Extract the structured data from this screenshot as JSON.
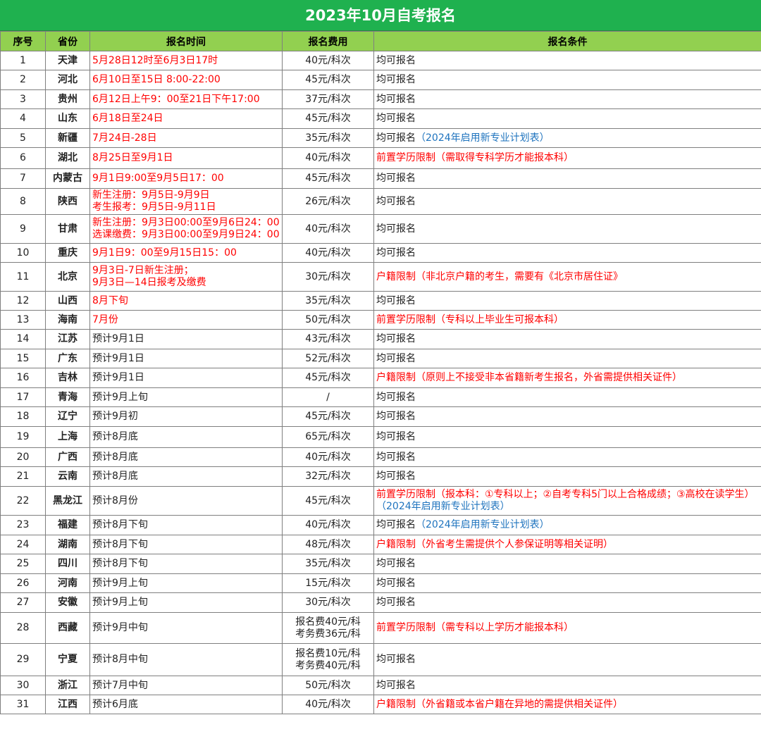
{
  "title": "2023年10月自考报名",
  "headers": [
    "序号",
    "省份",
    "报名时间",
    "报名费用",
    "报名条件"
  ],
  "colors": {
    "title_bg": "#1fb14f",
    "header_bg": "#92d050",
    "highlight_red": "#ff0000",
    "link_blue": "#1e73be"
  },
  "rows": [
    {
      "no": "1",
      "province": "天津",
      "time": "5月28日12时至6月3日17时",
      "time_red": true,
      "fee": "40元/科次",
      "cond": "均可报名",
      "cond_red": false,
      "note": ""
    },
    {
      "no": "2",
      "province": "河北",
      "time": "6月10日至15日 8:00-22:00",
      "time_red": true,
      "fee": "45元/科次",
      "cond": "均可报名",
      "cond_red": false,
      "note": ""
    },
    {
      "no": "3",
      "province": "贵州",
      "time": "6月12日上午9：00至21日下午17:00",
      "time_red": true,
      "fee": "37元/科次",
      "cond": "均可报名",
      "cond_red": false,
      "note": ""
    },
    {
      "no": "4",
      "province": "山东",
      "time": "6月18日至24日",
      "time_red": true,
      "fee": "45元/科次",
      "cond": "均可报名",
      "cond_red": false,
      "note": ""
    },
    {
      "no": "5",
      "province": "新疆",
      "time": "7月24日-28日",
      "time_red": true,
      "fee": "35元/科次",
      "cond": "均可报名",
      "cond_red": false,
      "note": "（2024年启用新专业计划表）"
    },
    {
      "no": "6",
      "province": "湖北",
      "time": "8月25日至9月1日",
      "time_red": true,
      "fee": "40元/科次",
      "cond": "前置学历限制（需取得专科学历才能报本科）",
      "cond_red": true,
      "note": ""
    },
    {
      "no": "7",
      "province": "内蒙古",
      "time": "9月1日9:00至9月5日17：00",
      "time_red": true,
      "fee": "45元/科次",
      "cond": "均可报名",
      "cond_red": false,
      "note": ""
    },
    {
      "no": "8",
      "province": "陕西",
      "time": "新生注册：9月5日-9月9日\n考生报考：9月5日-9月11日",
      "time_red": true,
      "fee": "26元/科次",
      "cond": "均可报名",
      "cond_red": false,
      "note": ""
    },
    {
      "no": "9",
      "province": "甘肃",
      "time": "新生注册：9月3日00:00至9月6日24：00\n选课缴费：9月3日00:00至9月9日24：00",
      "time_red": true,
      "fee": "40元/科次",
      "cond": "均可报名",
      "cond_red": false,
      "note": ""
    },
    {
      "no": "10",
      "province": "重庆",
      "time": "9月1日9：00至9月15日15：00",
      "time_red": true,
      "fee": "40元/科次",
      "cond": "均可报名",
      "cond_red": false,
      "note": ""
    },
    {
      "no": "11",
      "province": "北京",
      "time": "9月3日-7日新生注册；\n9月3日—14日报考及缴费",
      "time_red": true,
      "fee": "30元/科次",
      "cond": "户籍限制（非北京户籍的考生，需要有《北京市居住证》",
      "cond_red": true,
      "note": ""
    },
    {
      "no": "12",
      "province": "山西",
      "time": "8月下旬",
      "time_red": true,
      "fee": "35元/科次",
      "cond": "均可报名",
      "cond_red": false,
      "note": ""
    },
    {
      "no": "13",
      "province": "海南",
      "time": "7月份",
      "time_red": true,
      "fee": "50元/科次",
      "cond": "前置学历限制（专科以上毕业生可报本科）",
      "cond_red": true,
      "note": ""
    },
    {
      "no": "14",
      "province": "江苏",
      "time": "预计9月1日",
      "time_red": false,
      "fee": "43元/科次",
      "cond": "均可报名",
      "cond_red": false,
      "note": ""
    },
    {
      "no": "15",
      "province": "广东",
      "time": "预计9月1日",
      "time_red": false,
      "fee": "52元/科次",
      "cond": "均可报名",
      "cond_red": false,
      "note": ""
    },
    {
      "no": "16",
      "province": "吉林",
      "time": "预计9月1日",
      "time_red": false,
      "fee": "45元/科次",
      "cond": "户籍限制（原则上不接受非本省籍新考生报名，外省需提供相关证件）",
      "cond_red": true,
      "note": ""
    },
    {
      "no": "17",
      "province": "青海",
      "time": "预计9月上旬",
      "time_red": false,
      "fee": "/",
      "cond": "均可报名",
      "cond_red": false,
      "note": ""
    },
    {
      "no": "18",
      "province": "辽宁",
      "time": "预计9月初",
      "time_red": false,
      "fee": "45元/科次",
      "cond": "均可报名",
      "cond_red": false,
      "note": ""
    },
    {
      "no": "19",
      "province": "上海",
      "time": "预计8月底",
      "time_red": false,
      "fee": "65元/科次",
      "cond": "均可报名",
      "cond_red": false,
      "note": ""
    },
    {
      "no": "20",
      "province": "广西",
      "time": "预计8月底",
      "time_red": false,
      "fee": "40元/科次",
      "cond": "均可报名",
      "cond_red": false,
      "note": ""
    },
    {
      "no": "21",
      "province": "云南",
      "time": "预计8月底",
      "time_red": false,
      "fee": "32元/科次",
      "cond": "均可报名",
      "cond_red": false,
      "note": ""
    },
    {
      "no": "22",
      "province": "黑龙江",
      "time": "预计8月份",
      "time_red": false,
      "fee": "45元/科次",
      "cond": "前置学历限制（报本科：①专科以上；②自考专科5门以上合格成绩；③高校在读学生）",
      "cond_red": true,
      "note": "（2024年启用新专业计划表）"
    },
    {
      "no": "23",
      "province": "福建",
      "time": "预计8月下旬",
      "time_red": false,
      "fee": "40元/科次",
      "cond": "均可报名",
      "cond_red": false,
      "note": "（2024年启用新专业计划表）"
    },
    {
      "no": "24",
      "province": "湖南",
      "time": "预计8月下旬",
      "time_red": false,
      "fee": "48元/科次",
      "cond": "户籍限制（外省考生需提供个人参保证明等相关证明）",
      "cond_red": true,
      "note": ""
    },
    {
      "no": "25",
      "province": "四川",
      "time": "预计8月下旬",
      "time_red": false,
      "fee": "35元/科次",
      "cond": "均可报名",
      "cond_red": false,
      "note": ""
    },
    {
      "no": "26",
      "province": "河南",
      "time": "预计9月上旬",
      "time_red": false,
      "fee": "15元/科次",
      "cond": "均可报名",
      "cond_red": false,
      "note": ""
    },
    {
      "no": "27",
      "province": "安徽",
      "time": "预计9月上旬",
      "time_red": false,
      "fee": "30元/科次",
      "cond": "均可报名",
      "cond_red": false,
      "note": ""
    },
    {
      "no": "28",
      "province": "西藏",
      "time": "预计9月中旬",
      "time_red": false,
      "fee": "报名费40元/科\n考务费36元/科",
      "cond": "前置学历限制（需专科以上学历才能报本科）",
      "cond_red": true,
      "note": ""
    },
    {
      "no": "29",
      "province": "宁夏",
      "time": "预计8月中旬",
      "time_red": false,
      "fee": "报名费10元/科\n考务费40元/科",
      "cond": "均可报名",
      "cond_red": false,
      "note": ""
    },
    {
      "no": "30",
      "province": "浙江",
      "time": "预计7月中旬",
      "time_red": false,
      "fee": "50元/科次",
      "cond": "均可报名",
      "cond_red": false,
      "note": ""
    },
    {
      "no": "31",
      "province": "江西",
      "time": "预计6月底",
      "time_red": false,
      "fee": "40元/科次",
      "cond": "户籍限制（外省籍或本省户籍在异地的需提供相关证件）",
      "cond_red": true,
      "note": ""
    }
  ]
}
